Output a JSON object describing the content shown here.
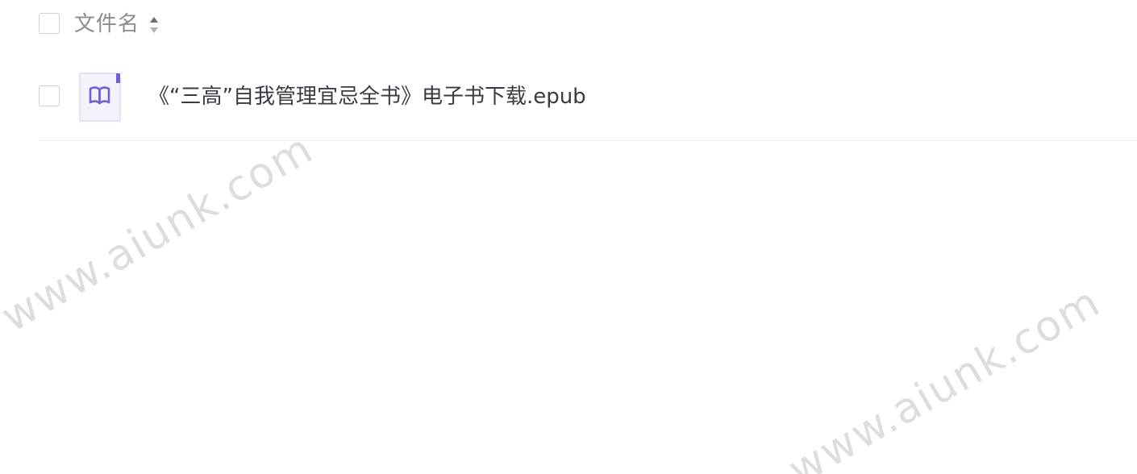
{
  "file_list": {
    "header": {
      "column_label": "文件名",
      "sort_icon": "sort-toggle-icon"
    },
    "rows": [
      {
        "name": "《“三高”自我管理宜忌全书》电子书下载.epub",
        "icon": "epub-book-icon",
        "selected": false
      }
    ]
  },
  "watermark": {
    "text": "www.aiunk.com"
  },
  "colors": {
    "icon_accent": "#6f5fd8",
    "icon_background": "#f4f3fb",
    "text_primary": "#3a3a44",
    "text_header": "#8b8b93"
  }
}
